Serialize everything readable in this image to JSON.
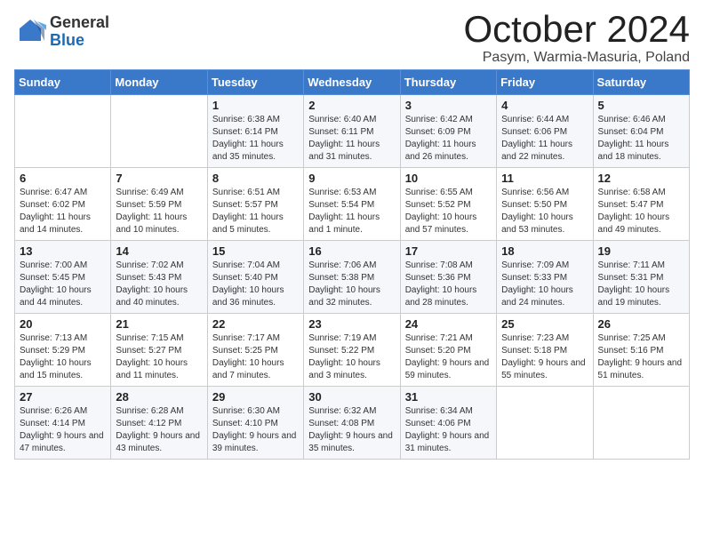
{
  "logo": {
    "general": "General",
    "blue": "Blue"
  },
  "title": "October 2024",
  "location": "Pasym, Warmia-Masuria, Poland",
  "days_header": [
    "Sunday",
    "Monday",
    "Tuesday",
    "Wednesday",
    "Thursday",
    "Friday",
    "Saturday"
  ],
  "weeks": [
    [
      {
        "day": "",
        "sunrise": "",
        "sunset": "",
        "daylight": ""
      },
      {
        "day": "",
        "sunrise": "",
        "sunset": "",
        "daylight": ""
      },
      {
        "day": "1",
        "sunrise": "Sunrise: 6:38 AM",
        "sunset": "Sunset: 6:14 PM",
        "daylight": "Daylight: 11 hours and 35 minutes."
      },
      {
        "day": "2",
        "sunrise": "Sunrise: 6:40 AM",
        "sunset": "Sunset: 6:11 PM",
        "daylight": "Daylight: 11 hours and 31 minutes."
      },
      {
        "day": "3",
        "sunrise": "Sunrise: 6:42 AM",
        "sunset": "Sunset: 6:09 PM",
        "daylight": "Daylight: 11 hours and 26 minutes."
      },
      {
        "day": "4",
        "sunrise": "Sunrise: 6:44 AM",
        "sunset": "Sunset: 6:06 PM",
        "daylight": "Daylight: 11 hours and 22 minutes."
      },
      {
        "day": "5",
        "sunrise": "Sunrise: 6:46 AM",
        "sunset": "Sunset: 6:04 PM",
        "daylight": "Daylight: 11 hours and 18 minutes."
      }
    ],
    [
      {
        "day": "6",
        "sunrise": "Sunrise: 6:47 AM",
        "sunset": "Sunset: 6:02 PM",
        "daylight": "Daylight: 11 hours and 14 minutes."
      },
      {
        "day": "7",
        "sunrise": "Sunrise: 6:49 AM",
        "sunset": "Sunset: 5:59 PM",
        "daylight": "Daylight: 11 hours and 10 minutes."
      },
      {
        "day": "8",
        "sunrise": "Sunrise: 6:51 AM",
        "sunset": "Sunset: 5:57 PM",
        "daylight": "Daylight: 11 hours and 5 minutes."
      },
      {
        "day": "9",
        "sunrise": "Sunrise: 6:53 AM",
        "sunset": "Sunset: 5:54 PM",
        "daylight": "Daylight: 11 hours and 1 minute."
      },
      {
        "day": "10",
        "sunrise": "Sunrise: 6:55 AM",
        "sunset": "Sunset: 5:52 PM",
        "daylight": "Daylight: 10 hours and 57 minutes."
      },
      {
        "day": "11",
        "sunrise": "Sunrise: 6:56 AM",
        "sunset": "Sunset: 5:50 PM",
        "daylight": "Daylight: 10 hours and 53 minutes."
      },
      {
        "day": "12",
        "sunrise": "Sunrise: 6:58 AM",
        "sunset": "Sunset: 5:47 PM",
        "daylight": "Daylight: 10 hours and 49 minutes."
      }
    ],
    [
      {
        "day": "13",
        "sunrise": "Sunrise: 7:00 AM",
        "sunset": "Sunset: 5:45 PM",
        "daylight": "Daylight: 10 hours and 44 minutes."
      },
      {
        "day": "14",
        "sunrise": "Sunrise: 7:02 AM",
        "sunset": "Sunset: 5:43 PM",
        "daylight": "Daylight: 10 hours and 40 minutes."
      },
      {
        "day": "15",
        "sunrise": "Sunrise: 7:04 AM",
        "sunset": "Sunset: 5:40 PM",
        "daylight": "Daylight: 10 hours and 36 minutes."
      },
      {
        "day": "16",
        "sunrise": "Sunrise: 7:06 AM",
        "sunset": "Sunset: 5:38 PM",
        "daylight": "Daylight: 10 hours and 32 minutes."
      },
      {
        "day": "17",
        "sunrise": "Sunrise: 7:08 AM",
        "sunset": "Sunset: 5:36 PM",
        "daylight": "Daylight: 10 hours and 28 minutes."
      },
      {
        "day": "18",
        "sunrise": "Sunrise: 7:09 AM",
        "sunset": "Sunset: 5:33 PM",
        "daylight": "Daylight: 10 hours and 24 minutes."
      },
      {
        "day": "19",
        "sunrise": "Sunrise: 7:11 AM",
        "sunset": "Sunset: 5:31 PM",
        "daylight": "Daylight: 10 hours and 19 minutes."
      }
    ],
    [
      {
        "day": "20",
        "sunrise": "Sunrise: 7:13 AM",
        "sunset": "Sunset: 5:29 PM",
        "daylight": "Daylight: 10 hours and 15 minutes."
      },
      {
        "day": "21",
        "sunrise": "Sunrise: 7:15 AM",
        "sunset": "Sunset: 5:27 PM",
        "daylight": "Daylight: 10 hours and 11 minutes."
      },
      {
        "day": "22",
        "sunrise": "Sunrise: 7:17 AM",
        "sunset": "Sunset: 5:25 PM",
        "daylight": "Daylight: 10 hours and 7 minutes."
      },
      {
        "day": "23",
        "sunrise": "Sunrise: 7:19 AM",
        "sunset": "Sunset: 5:22 PM",
        "daylight": "Daylight: 10 hours and 3 minutes."
      },
      {
        "day": "24",
        "sunrise": "Sunrise: 7:21 AM",
        "sunset": "Sunset: 5:20 PM",
        "daylight": "Daylight: 9 hours and 59 minutes."
      },
      {
        "day": "25",
        "sunrise": "Sunrise: 7:23 AM",
        "sunset": "Sunset: 5:18 PM",
        "daylight": "Daylight: 9 hours and 55 minutes."
      },
      {
        "day": "26",
        "sunrise": "Sunrise: 7:25 AM",
        "sunset": "Sunset: 5:16 PM",
        "daylight": "Daylight: 9 hours and 51 minutes."
      }
    ],
    [
      {
        "day": "27",
        "sunrise": "Sunrise: 6:26 AM",
        "sunset": "Sunset: 4:14 PM",
        "daylight": "Daylight: 9 hours and 47 minutes."
      },
      {
        "day": "28",
        "sunrise": "Sunrise: 6:28 AM",
        "sunset": "Sunset: 4:12 PM",
        "daylight": "Daylight: 9 hours and 43 minutes."
      },
      {
        "day": "29",
        "sunrise": "Sunrise: 6:30 AM",
        "sunset": "Sunset: 4:10 PM",
        "daylight": "Daylight: 9 hours and 39 minutes."
      },
      {
        "day": "30",
        "sunrise": "Sunrise: 6:32 AM",
        "sunset": "Sunset: 4:08 PM",
        "daylight": "Daylight: 9 hours and 35 minutes."
      },
      {
        "day": "31",
        "sunrise": "Sunrise: 6:34 AM",
        "sunset": "Sunset: 4:06 PM",
        "daylight": "Daylight: 9 hours and 31 minutes."
      },
      {
        "day": "",
        "sunrise": "",
        "sunset": "",
        "daylight": ""
      },
      {
        "day": "",
        "sunrise": "",
        "sunset": "",
        "daylight": ""
      }
    ]
  ]
}
